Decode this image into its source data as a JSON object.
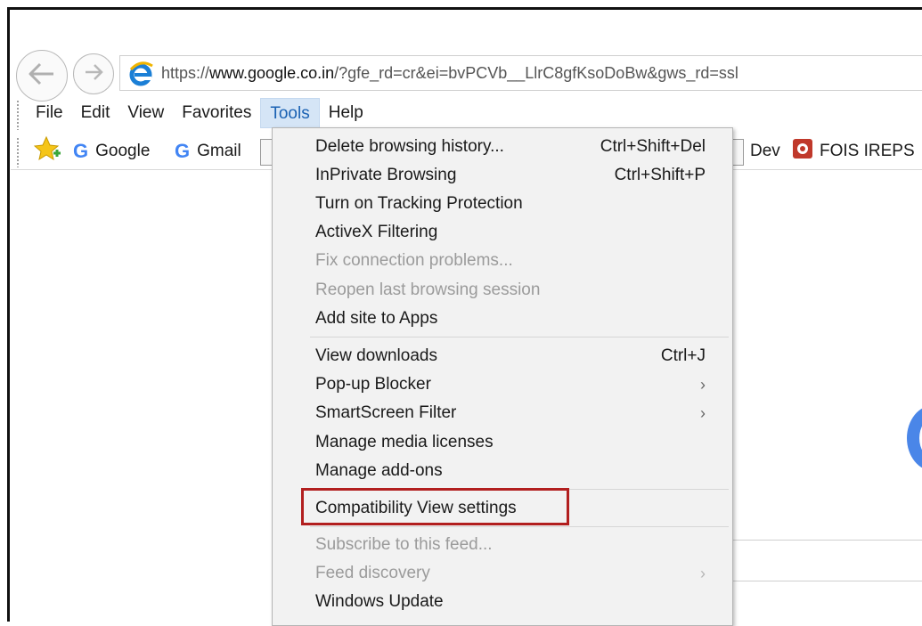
{
  "address_bar": {
    "url_prefix": "https://",
    "url_domain": "www.google.co.in",
    "url_rest": "/?gfe_rd=cr&ei=bvPCVb__LlrC8gfKsoDoBw&gws_rd=ssl"
  },
  "menu_bar": [
    "File",
    "Edit",
    "View",
    "Favorites",
    "Tools",
    "Help"
  ],
  "active_menu": "Tools",
  "favorites": {
    "google": "Google",
    "gmail": "Gmail",
    "dev": "Dev",
    "fois": "FOIS IREPS"
  },
  "tools_menu": {
    "delete_history": {
      "label": "Delete browsing history...",
      "shortcut": "Ctrl+Shift+Del"
    },
    "inprivate": {
      "label": "InPrivate Browsing",
      "shortcut": "Ctrl+Shift+P"
    },
    "tracking": {
      "label": "Turn on Tracking Protection"
    },
    "activex": {
      "label": "ActiveX Filtering"
    },
    "fix_connection": {
      "label": "Fix connection problems..."
    },
    "reopen_session": {
      "label": "Reopen last browsing session"
    },
    "add_site": {
      "label": "Add site to Apps"
    },
    "downloads": {
      "label": "View downloads",
      "shortcut": "Ctrl+J"
    },
    "popup_blocker": {
      "label": "Pop-up Blocker"
    },
    "smartscreen": {
      "label": "SmartScreen Filter"
    },
    "media_licenses": {
      "label": "Manage media licenses"
    },
    "addons": {
      "label": "Manage add-ons"
    },
    "compat_view": {
      "label": "Compatibility View settings"
    },
    "subscribe": {
      "label": "Subscribe to this feed..."
    },
    "feed_discovery": {
      "label": "Feed discovery"
    },
    "windows_update": {
      "label": "Windows Update"
    }
  },
  "colors": {
    "highlight_box": "#b21f1f",
    "active_menu_bg": "#d5e5f6",
    "ie_logo": "#1b7fd6"
  }
}
